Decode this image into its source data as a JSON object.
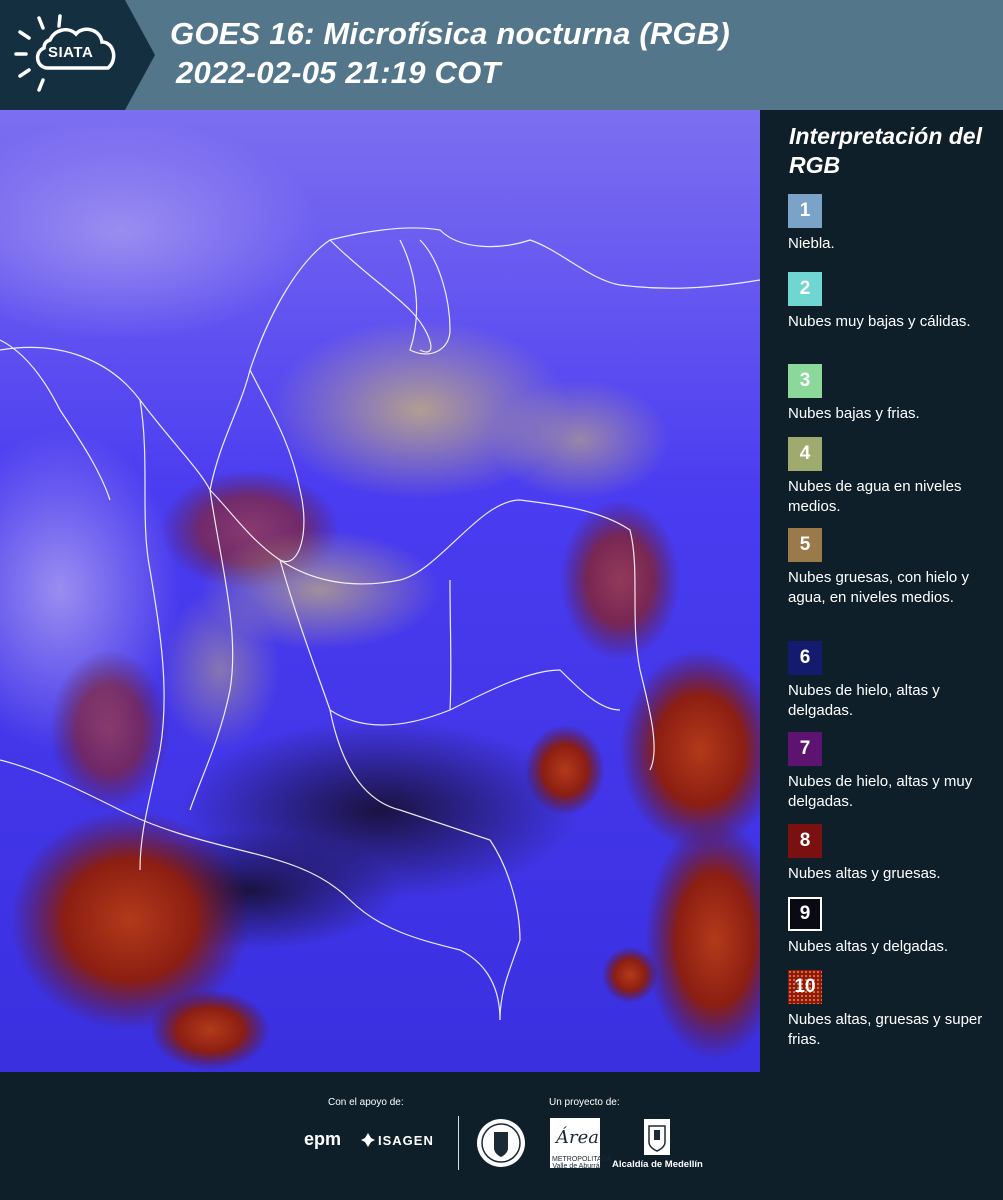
{
  "header": {
    "logo_text": "SIATA",
    "title_line1": "GOES 16: Microfísica nocturna (RGB)",
    "title_line2": "2022-02-05 21:19 COT"
  },
  "map": {
    "icon": "satellite-rgb-composite-map"
  },
  "legend": {
    "title": "Interpretación del RGB",
    "items": [
      {
        "number": "1",
        "label": "Niebla.",
        "color": "#7aa3c7"
      },
      {
        "number": "2",
        "label": "Nubes muy bajas y cálidas.",
        "color": "#6fd6d2"
      },
      {
        "number": "3",
        "label": "Nubes bajas y frias.",
        "color": "#8ad99a"
      },
      {
        "number": "4",
        "label": "Nubes de agua en niveles medios.",
        "color": "#9fab6e"
      },
      {
        "number": "5",
        "label": "Nubes gruesas, con hielo y agua, en niveles medios.",
        "color": "#9a7a4a"
      },
      {
        "number": "6",
        "label": "Nubes de hielo, altas y delgadas.",
        "color": "#131b6e"
      },
      {
        "number": "7",
        "label": "Nubes de hielo, altas y muy delgadas.",
        "color": "#5c1470"
      },
      {
        "number": "8",
        "label": "Nubes altas y gruesas.",
        "color": "#7a1010"
      },
      {
        "number": "9",
        "label": "Nubes altas y delgadas.",
        "color": "#0a0a14"
      },
      {
        "number": "10",
        "label": "Nubes altas, gruesas y super frias.",
        "color": "#8a1a0e"
      }
    ]
  },
  "footer": {
    "support_label": "Con el apoyo de:",
    "project_label": "Un proyecto de:",
    "sponsor1": "epm",
    "sponsor2": "ISAGEN",
    "partner_area": "Área",
    "partner_area_sub": "METROPOLITANA Valle de Aburrá",
    "partner_alcaldia": "Alcaldía de Medellín"
  }
}
